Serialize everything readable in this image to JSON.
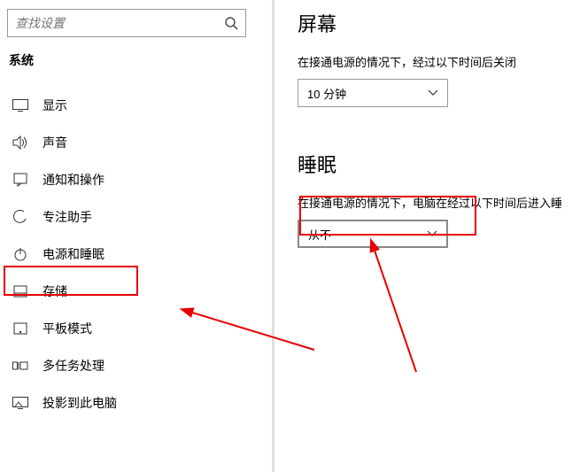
{
  "search": {
    "placeholder": "查找设置"
  },
  "sidebar": {
    "heading": "系统",
    "items": [
      {
        "label": "显示"
      },
      {
        "label": "声音"
      },
      {
        "label": "通知和操作"
      },
      {
        "label": "专注助手"
      },
      {
        "label": "电源和睡眠"
      },
      {
        "label": "存储"
      },
      {
        "label": "平板模式"
      },
      {
        "label": "多任务处理"
      },
      {
        "label": "投影到此电脑"
      }
    ]
  },
  "content": {
    "screen": {
      "title": "屏幕",
      "label": "在接通电源的情况下，经过以下时间后关闭",
      "value": "10 分钟"
    },
    "sleep": {
      "title": "睡眠",
      "label": "在接通电源的情况下，电脑在经过以下时间后进入睡",
      "value": "从不"
    }
  }
}
